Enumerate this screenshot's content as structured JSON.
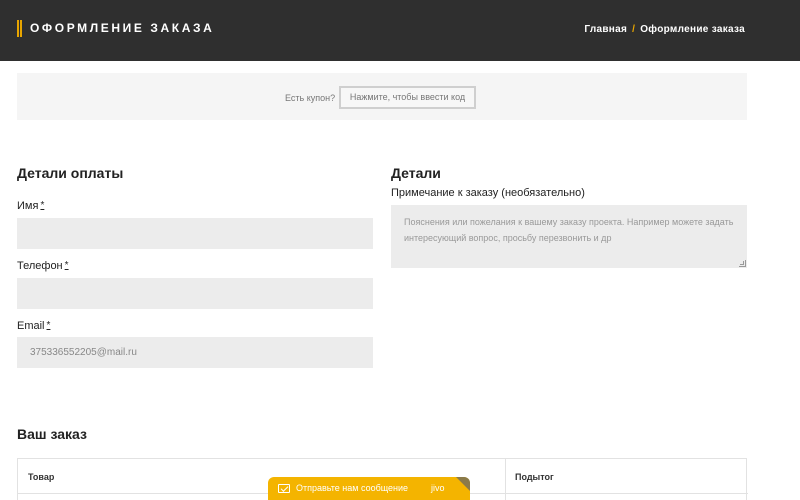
{
  "header": {
    "title": "Оформление заказа",
    "breadcrumb": {
      "home": "Главная",
      "separator": "/",
      "current": "Оформление заказа"
    }
  },
  "coupon": {
    "label": "Есть купон?",
    "button": "Нажмите, чтобы ввести код"
  },
  "billing": {
    "title": "Детали оплаты",
    "name_label": "Имя",
    "phone_label": "Телефон",
    "email_label": "Email",
    "required_mark": "*",
    "name_value": "",
    "phone_value": "",
    "email_value": "375336552205@mail.ru"
  },
  "details": {
    "title": "Детали",
    "note_label": "Примечание к заказу (необязательно)",
    "note_placeholder": "Пояснения или пожелания к вашему заказу проекта. Например можете задать интересующий вопрос, просьбу перезвонить и др"
  },
  "order": {
    "title": "Ваш заказ",
    "columns": [
      "Товар",
      "Подытог"
    ]
  },
  "chat": {
    "text": "Отправьте нам сообщение",
    "brand": "jivo"
  },
  "colors": {
    "accent": "#e8a500",
    "header_bg": "#2f2f2f",
    "chat_bg": "#f4b400"
  }
}
